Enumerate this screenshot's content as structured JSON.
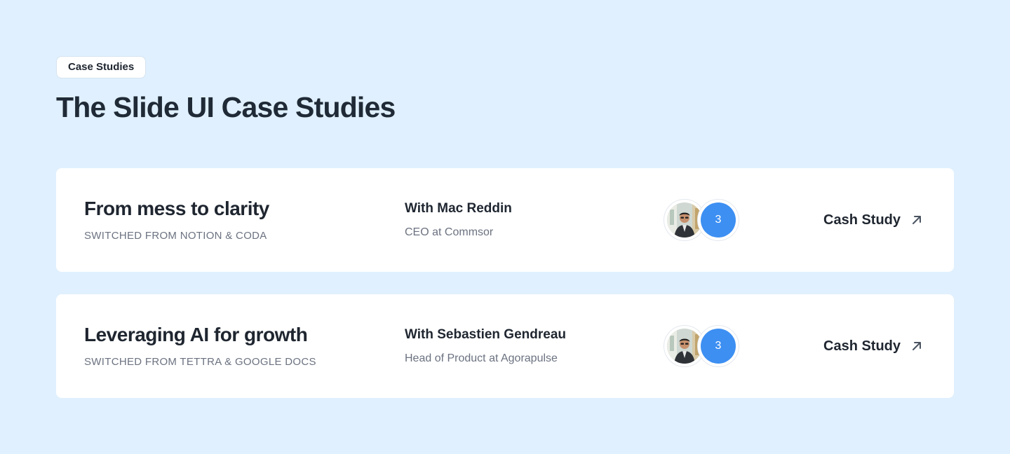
{
  "header": {
    "badge": "Case Studies",
    "title": "The Slide UI Case Studies"
  },
  "cases": [
    {
      "headline": "From mess to clarity",
      "subhead": "SWITCHED FROM NOTION & CODA",
      "person_name": "With Mac Reddin",
      "person_role": "CEO at Commsor",
      "avatar_count": "3",
      "link_label": "Cash Study"
    },
    {
      "headline": "Leveraging AI for growth",
      "subhead": "SWITCHED FROM TETTRA & GOOGLE DOCS",
      "person_name": "With Sebastien Gendreau",
      "person_role": "Head of Product at Agorapulse",
      "avatar_count": "3",
      "link_label": "Cash Study"
    }
  ],
  "colors": {
    "background": "#e0f0fe",
    "card": "#ffffff",
    "accent": "#3d8ff2",
    "text": "#1f2630",
    "muted": "#6b7280"
  },
  "icons": {
    "link": "arrow-up-right-icon",
    "avatar": "person-avatar"
  }
}
